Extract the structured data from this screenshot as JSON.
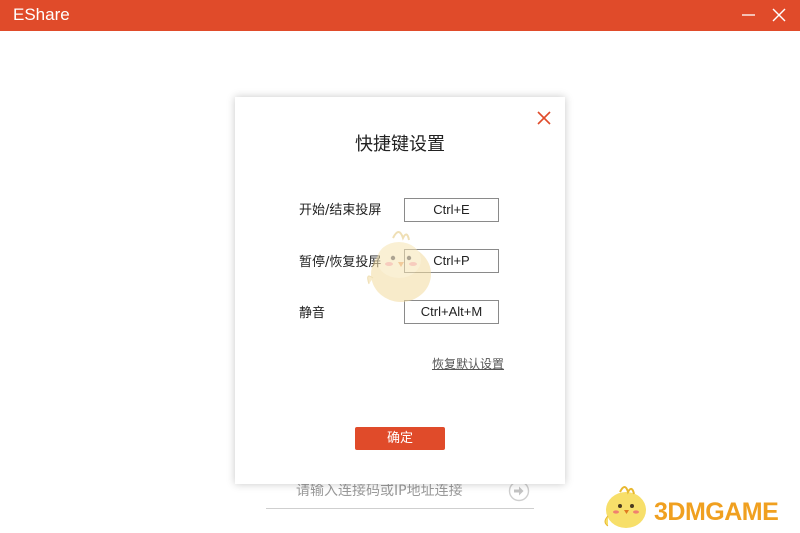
{
  "window": {
    "title": "EShare",
    "titlebar_color": "#e04b2a",
    "controls": [
      "minimize-icon",
      "close-icon"
    ]
  },
  "main": {
    "connect_input": {
      "placeholder": "请输入连接码或IP地址连接",
      "value": ""
    },
    "connect_button_icon": "arrow-right-circle-icon"
  },
  "dialog": {
    "title": "快捷键设置",
    "close_icon": "close-icon",
    "rows": [
      {
        "label": "开始/结束投屏",
        "value": "Ctrl+E"
      },
      {
        "label": "暂停/恢复投屏",
        "value": "Ctrl+P"
      },
      {
        "label": "静音",
        "value": "Ctrl+Alt+M"
      }
    ],
    "restore_link": "恢复默认设置",
    "confirm_button": "确定",
    "accent_color": "#e04b2a"
  },
  "watermark": {
    "text": "3DMGAME",
    "mascot_icon": "chick-mascot-icon"
  }
}
